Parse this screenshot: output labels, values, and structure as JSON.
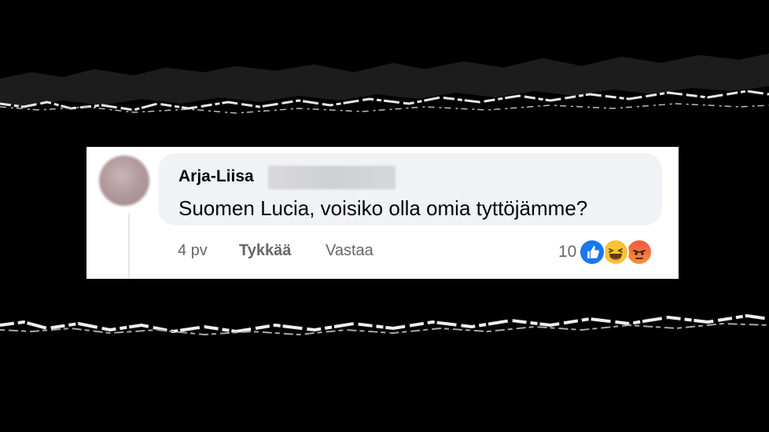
{
  "comment": {
    "author": "Arja-Liisa",
    "text": "Suomen Lucia, voisiko olla omia tyttöjämme?",
    "age": "4 pv",
    "like_label": "Tykkää",
    "reply_label": "Vastaa",
    "reaction_count": "10",
    "reactions": [
      "like-reaction-icon",
      "haha-reaction-icon",
      "angry-reaction-icon"
    ]
  },
  "colors": {
    "background": "#000000",
    "card": "#ffffff",
    "bubble": "#f0f2f5",
    "text": "#050505",
    "muted": "#65676b",
    "like_blue": "#1877f2"
  }
}
